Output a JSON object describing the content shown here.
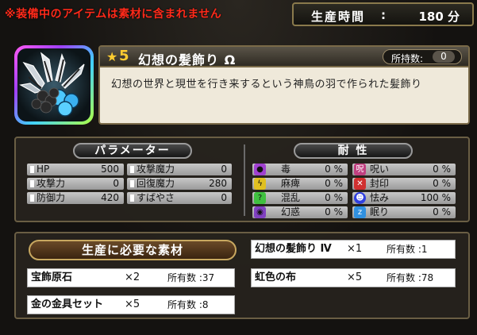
{
  "warning_text": "※装備中のアイテムは素材に含まれません",
  "production": {
    "label": "生産時間",
    "colon": ":",
    "value": "180 分"
  },
  "item": {
    "rarity": "5",
    "name": "幻想の髪飾り Ω",
    "owned_label": "所持数:",
    "owned_value": "0",
    "description": "幻想の世界と現世を行き来するという神鳥の羽で作られた髪飾り"
  },
  "parameters": {
    "title": "パラメーター",
    "stats": [
      {
        "label": "HP",
        "value": "500"
      },
      {
        "label": "攻撃力",
        "value": "0"
      },
      {
        "label": "防御力",
        "value": "420"
      },
      {
        "label": "攻撃魔力",
        "value": "0"
      },
      {
        "label": "回復魔力",
        "value": "280"
      },
      {
        "label": "すばやさ",
        "value": "0"
      }
    ]
  },
  "resistance": {
    "title": "耐 性",
    "items": [
      {
        "label": "毒",
        "value": "0 %",
        "icon": "poison-icon",
        "color": "#a040d0"
      },
      {
        "label": "麻痺",
        "value": "0 %",
        "icon": "paralysis-icon",
        "color": "#e0c020"
      },
      {
        "label": "混乱",
        "value": "0 %",
        "icon": "confusion-icon",
        "color": "#40c040"
      },
      {
        "label": "幻惑",
        "value": "0 %",
        "icon": "illusion-icon",
        "color": "#8040c0"
      },
      {
        "label": "呪い",
        "value": "0 %",
        "icon": "curse-icon",
        "color": "#c04080"
      },
      {
        "label": "封印",
        "value": "0 %",
        "icon": "seal-icon",
        "color": "#d03030"
      },
      {
        "label": "怯み",
        "value": "100 %",
        "icon": "flinch-icon",
        "color": "#3040e0"
      },
      {
        "label": "眠り",
        "value": "0 %",
        "icon": "sleep-icon",
        "color": "#3090e0"
      }
    ]
  },
  "materials": {
    "title": "生産に必要な素材",
    "items": [
      {
        "name": "幻想の髪飾り Ⅳ",
        "qty": "×1",
        "owned": "所有数 :1"
      },
      {
        "name": "宝飾原石",
        "qty": "×2",
        "owned": "所有数 :37"
      },
      {
        "name": "虹色の布",
        "qty": "×5",
        "owned": "所有数 :78"
      },
      {
        "name": "金の金具セット",
        "qty": "×5",
        "owned": "所有数 :8"
      }
    ]
  }
}
